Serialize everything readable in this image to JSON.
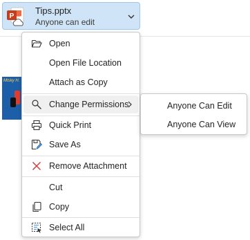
{
  "attachment": {
    "file_name": "Tips.pptx",
    "permission": "Anyone can edit",
    "icon": "powerpoint-cloud-icon",
    "dropdown_icon": "chevron-down-icon"
  },
  "context_menu": {
    "open": "Open",
    "open_file_location": "Open File Location",
    "attach_as_copy": "Attach as Copy",
    "change_permissions": "Change Permissions",
    "quick_print": "Quick Print",
    "save_as": "Save As",
    "remove_attachment": "Remove Attachment",
    "cut": "Cut",
    "copy": "Copy",
    "select_all": "Select All"
  },
  "permissions_submenu": {
    "anyone_can_edit": "Anyone Can Edit",
    "anyone_can_view": "Anyone Can View"
  },
  "colors": {
    "attachment_bg": "#cfe4f7",
    "ppt_brand": "#c43e1c",
    "remove_icon": "#d13438",
    "save_icon_accent": "#5a9bd5"
  }
}
